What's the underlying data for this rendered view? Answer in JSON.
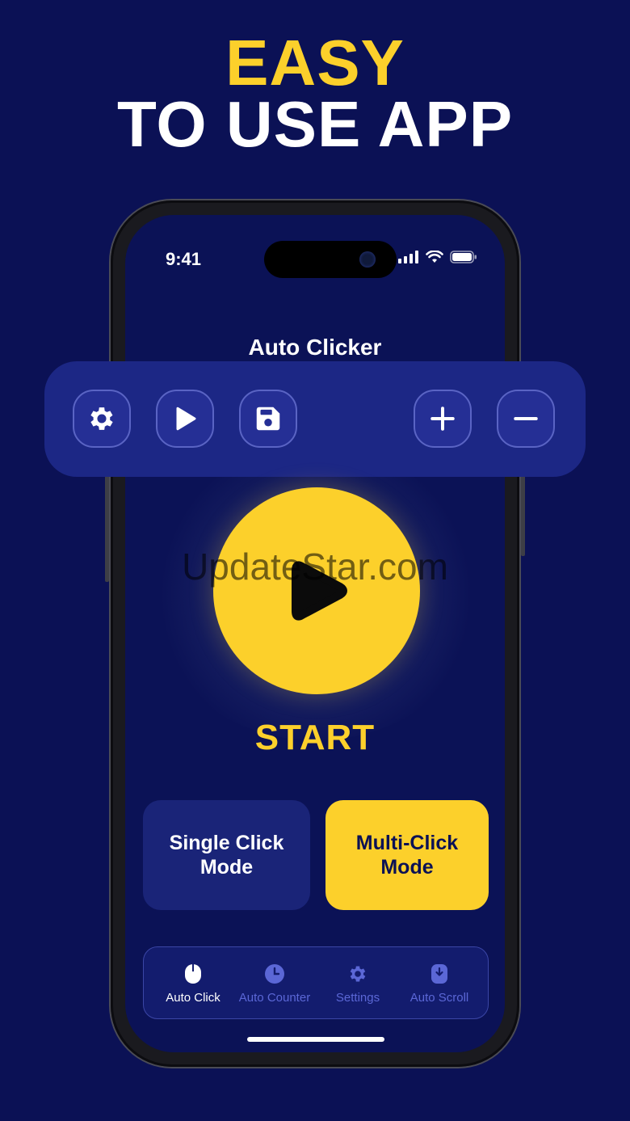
{
  "headline": {
    "line1": "EASY",
    "line2": "TO USE APP"
  },
  "status_bar": {
    "time": "9:41"
  },
  "app": {
    "title": "Auto Clicker"
  },
  "toolbar": {
    "buttons": [
      {
        "name": "settings",
        "icon": "gear-icon"
      },
      {
        "name": "play",
        "icon": "play-icon"
      },
      {
        "name": "save",
        "icon": "floppy-disk-icon"
      },
      {
        "name": "add",
        "icon": "plus-icon"
      },
      {
        "name": "remove",
        "icon": "minus-icon"
      }
    ]
  },
  "start": {
    "label": "START"
  },
  "watermark": "UpdateStar.com",
  "modes": {
    "single": "Single Click Mode",
    "multi": "Multi-Click Mode"
  },
  "nav": {
    "items": [
      {
        "label": "Auto Click",
        "icon": "mouse-icon",
        "active": true
      },
      {
        "label": "Auto Counter",
        "icon": "clock-icon",
        "active": false
      },
      {
        "label": "Settings",
        "icon": "gear-icon",
        "active": false
      },
      {
        "label": "Auto Scroll",
        "icon": "scroll-mouse-icon",
        "active": false
      }
    ]
  },
  "colors": {
    "background": "#0b1155",
    "accent": "#fcd02b",
    "toolbar": "#1c2785",
    "inactive_nav": "#5b67d6"
  }
}
